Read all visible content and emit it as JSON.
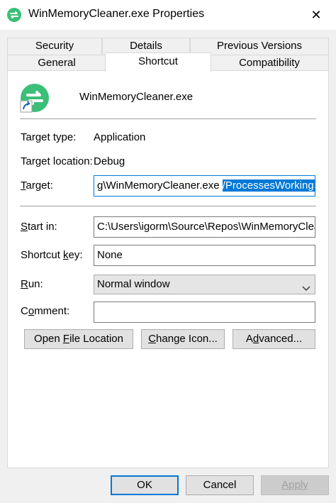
{
  "window": {
    "title": "WinMemoryCleaner.exe Properties",
    "close_glyph": "✕",
    "icon": "app-refresh-icon",
    "accent_green": "#3bbf77"
  },
  "tabs": {
    "row1": [
      "Security",
      "Details",
      "Previous Versions"
    ],
    "row2": [
      "General",
      "Shortcut",
      "Compatibility"
    ],
    "active": "Shortcut"
  },
  "shortcut": {
    "file_name": "WinMemoryCleaner.exe",
    "target_type_label": "Target type:",
    "target_type_value": "Application",
    "target_location_label": "Target location:",
    "target_location_value": "Debug",
    "target_label": "Target:",
    "target_value_prefix": "g\\WinMemoryCleaner.exe",
    "target_value_selected": "/ProcessesWorkingSet",
    "start_in_label": "Start in:",
    "start_in_value": "C:\\Users\\igorm\\Source\\Repos\\WinMemoryClean",
    "shortcut_key_label": "Shortcut key:",
    "shortcut_key_value": "None",
    "run_label": "Run:",
    "run_value": "Normal window",
    "comment_label": "Comment:",
    "comment_value": ""
  },
  "actions": {
    "open_file_location": "Open File Location",
    "change_icon": "Change Icon...",
    "advanced": "Advanced..."
  },
  "footer": {
    "ok": "OK",
    "cancel": "Cancel",
    "apply": "Apply"
  },
  "colors": {
    "selection": "#0078d7",
    "panel_border": "#d9d9d9",
    "dialog_bg": "#f0f0f0"
  }
}
